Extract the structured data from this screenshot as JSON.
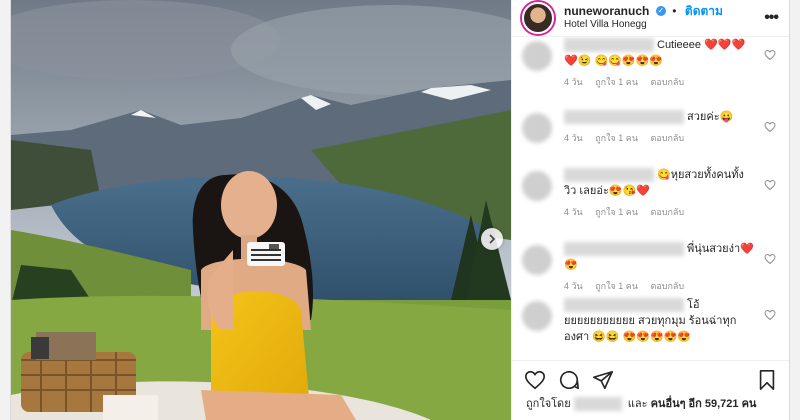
{
  "header": {
    "username": "nuneworanuch",
    "follow_label": "ติดตาม",
    "location": "Hotel Villa Honegg"
  },
  "comments": [
    {
      "text": "Cutieeee ❤️❤️❤️❤️😉 😋😋😍😍😍",
      "time": "4 วัน",
      "likes": "ถูกใจ 1 คน",
      "reply": "ตอบกลับ"
    },
    {
      "text": "สวยค่ะ😛",
      "time": "4 วัน",
      "likes": "ถูกใจ 1 คน",
      "reply": "ตอบกลับ"
    },
    {
      "text": "😋หุยสวยทั้งคนทั้งวิว เลยอ่ะ😍😘❤️",
      "time": "4 วัน",
      "likes": "ถูกใจ 1 คน",
      "reply": "ตอบกลับ"
    },
    {
      "text": "พี่นุ่นสวยง่า❤️😍",
      "time": "4 วัน",
      "likes": "ถูกใจ 1 คน",
      "reply": "ตอบกลับ"
    },
    {
      "text": "โอ้ยยยยยยยยยยย สวยทุกมุม ร้อนฉ่าทุกองศา 😆😆 😍😍😍😍😍",
      "time": "",
      "likes": "",
      "reply": ""
    }
  ],
  "likes_summary": {
    "prefix": "ถูกใจโดย",
    "middle": "และ",
    "others": "คนอื่นๆ อีก 59,721 คน"
  },
  "icons": [
    "heart-icon",
    "comment-icon",
    "share-icon",
    "bookmark-icon",
    "more-options-icon",
    "chevron-right-icon",
    "verified-icon"
  ]
}
